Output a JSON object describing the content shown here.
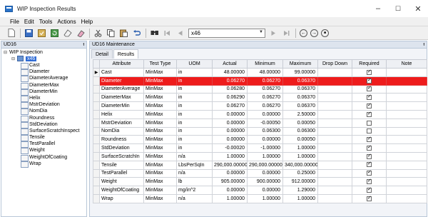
{
  "window": {
    "title": "WIP Inspection Results",
    "controls": [
      "–",
      "☐",
      "✕"
    ]
  },
  "menu": [
    "File",
    "Edit",
    "Tools",
    "Actions",
    "Help"
  ],
  "toolbar": {
    "record_value": "x46"
  },
  "left_panel": {
    "title": "UD16",
    "pin": "ᵻ",
    "root": "WIP Inspection",
    "selected_node": "x46",
    "children": [
      "Cast",
      "Diameter",
      "DiameterAverage",
      "DiameterMax",
      "DiameterMin",
      "Helix",
      "MstrDeviation",
      "NomDia",
      "Roundness",
      "StdDeviation",
      "SurfaceScratchInspect",
      "Tensile",
      "TestParallel",
      "Weight",
      "WeightOfCoating",
      "Wrap"
    ]
  },
  "right_panel": {
    "title": "UD16 Maintenance",
    "pin": "ᵻ",
    "tabs": [
      "Detail",
      "Results"
    ],
    "active_tab": "Results",
    "columns": [
      "Attribute",
      "Test Type",
      "UOM",
      "Actual",
      "Minimum",
      "Maximum",
      "Drop Down",
      "Required",
      "Note"
    ],
    "rows": [
      {
        "indicator": "▶",
        "attribute": "Cast",
        "test_type": "MinMax",
        "uom": "in",
        "actual": "48.00000",
        "minimum": "48.00000",
        "maximum": "99.00000",
        "drop_down": "",
        "required": true,
        "note": ""
      },
      {
        "indicator": "",
        "attribute": "Diameter",
        "test_type": "MinMax",
        "uom": "in",
        "actual": "0.06270",
        "minimum": "0.06270",
        "maximum": "0.06370",
        "drop_down": "",
        "required": true,
        "note": "",
        "selected": true
      },
      {
        "indicator": "",
        "attribute": "DiameterAverage",
        "test_type": "MinMax",
        "uom": "in",
        "actual": "0.06280",
        "minimum": "0.06270",
        "maximum": "0.06370",
        "drop_down": "",
        "required": true,
        "note": ""
      },
      {
        "indicator": "",
        "attribute": "DiameterMax",
        "test_type": "MinMax",
        "uom": "in",
        "actual": "0.06290",
        "minimum": "0.06270",
        "maximum": "0.06370",
        "drop_down": "",
        "required": true,
        "note": ""
      },
      {
        "indicator": "",
        "attribute": "DiameterMin",
        "test_type": "MinMax",
        "uom": "in",
        "actual": "0.06270",
        "minimum": "0.06270",
        "maximum": "0.06370",
        "drop_down": "",
        "required": true,
        "note": ""
      },
      {
        "indicator": "",
        "attribute": "Helix",
        "test_type": "MinMax",
        "uom": "in",
        "actual": "0.00000",
        "minimum": "0.00000",
        "maximum": "2.50000",
        "drop_down": "",
        "required": true,
        "note": ""
      },
      {
        "indicator": "",
        "attribute": "MstrDeviation",
        "test_type": "MinMax",
        "uom": "in",
        "actual": "0.00000",
        "minimum": "-0.00050",
        "maximum": "0.00050",
        "drop_down": "",
        "required": false,
        "note": ""
      },
      {
        "indicator": "",
        "attribute": "NomDia",
        "test_type": "MinMax",
        "uom": "in",
        "actual": "0.00000",
        "minimum": "0.06300",
        "maximum": "0.06300",
        "drop_down": "",
        "required": false,
        "note": ""
      },
      {
        "indicator": "",
        "attribute": "Roundness",
        "test_type": "MinMax",
        "uom": "in",
        "actual": "0.00000",
        "minimum": "0.00000",
        "maximum": "0.00050",
        "drop_down": "",
        "required": true,
        "note": ""
      },
      {
        "indicator": "",
        "attribute": "StdDeviation",
        "test_type": "MinMax",
        "uom": "in",
        "actual": "-0.00020",
        "minimum": "-1.00000",
        "maximum": "1.00000",
        "drop_down": "",
        "required": true,
        "note": ""
      },
      {
        "indicator": "",
        "attribute": "SurfaceScratchIn",
        "test_type": "MinMax",
        "uom": "n/a",
        "actual": "1.00000",
        "minimum": "1.00000",
        "maximum": "1.00000",
        "drop_down": "",
        "required": true,
        "note": ""
      },
      {
        "indicator": "",
        "attribute": "Tensile",
        "test_type": "MinMax",
        "uom": "LbsPerSqIn",
        "actual": "290,000.00000",
        "minimum": "290,000.00000",
        "maximum": "340,000.00000",
        "drop_down": "",
        "required": true,
        "note": ""
      },
      {
        "indicator": "",
        "attribute": "TestParallel",
        "test_type": "MinMax",
        "uom": "n/a",
        "actual": "0.00000",
        "minimum": "0.00000",
        "maximum": "0.25000",
        "drop_down": "",
        "required": true,
        "note": ""
      },
      {
        "indicator": "",
        "attribute": "Weight",
        "test_type": "MinMax",
        "uom": "lb",
        "actual": "905.00000",
        "minimum": "900.00000",
        "maximum": "912.00000",
        "drop_down": "",
        "required": true,
        "note": ""
      },
      {
        "indicator": "",
        "attribute": "WeightOfCoating",
        "test_type": "MinMax",
        "uom": "mg/in^2",
        "actual": "0.00000",
        "minimum": "0.00000",
        "maximum": "1.29000",
        "drop_down": "",
        "required": true,
        "note": ""
      },
      {
        "indicator": "",
        "attribute": "Wrap",
        "test_type": "MinMax",
        "uom": "n/a",
        "actual": "1.00000",
        "minimum": "1.00000",
        "maximum": "1.00000",
        "drop_down": "",
        "required": true,
        "note": ""
      }
    ]
  },
  "colors": {
    "selected_row": "#ee1c1c",
    "tree_selection": "#2f6bd4",
    "panel_header": "#dde4ee"
  }
}
